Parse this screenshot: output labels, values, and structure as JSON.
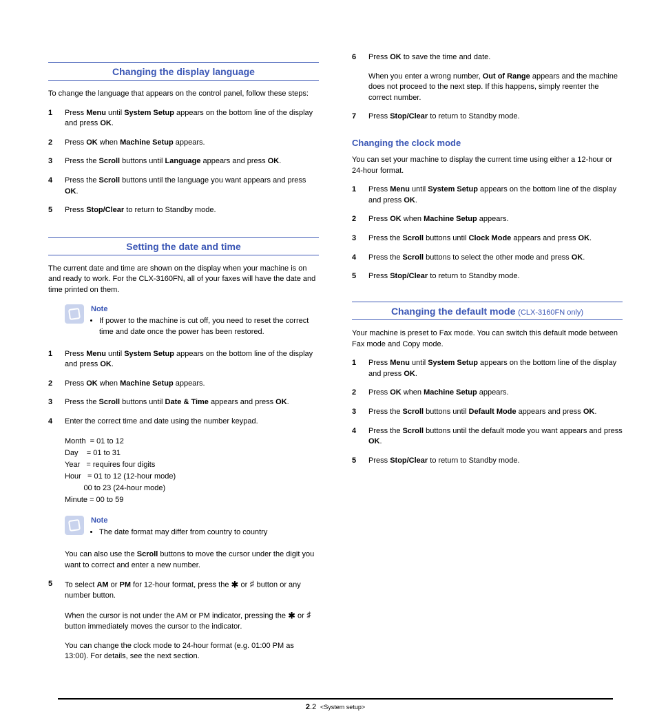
{
  "left": {
    "sec1": {
      "title": "Changing the display language",
      "intro": "To change the language that appears on the control panel, follow these steps:",
      "steps": [
        {
          "n": "1",
          "html": "Press <b>Menu</b> until <b>System Setup</b> appears on the bottom line of the display and press <b>OK</b>."
        },
        {
          "n": "2",
          "html": "Press <b>OK</b> when <b>Machine Setup</b> appears."
        },
        {
          "n": "3",
          "html": "Press the <b>Scroll</b> buttons until <b>Language</b> appears and press <b>OK</b>."
        },
        {
          "n": "4",
          "html": "Press the <b>Scroll</b> buttons until the language you want appears and press <b>OK</b>."
        },
        {
          "n": "5",
          "html": "Press <b>Stop/Clear</b> to return to Standby mode."
        }
      ]
    },
    "sec2": {
      "title": "Setting the date and time",
      "intro": "The current date and time are shown on the display when your machine is on and ready to work. For the CLX-3160FN, all of your faxes will have the date and time printed on them.",
      "note1": {
        "label": "Note",
        "text": "If power to the machine is cut off, you need to reset the correct time and date once the power has been restored."
      },
      "steps_a": [
        {
          "n": "1",
          "html": "Press <b>Menu</b> until <b>System Setup</b> appears on the bottom line of the display and press <b>OK</b>."
        },
        {
          "n": "2",
          "html": "Press <b>OK</b> when <b>Machine Setup</b> appears."
        },
        {
          "n": "3",
          "html": "Press the <b>Scroll</b> buttons until <b>Date & Time</b> appears and press <b>OK</b>."
        },
        {
          "n": "4",
          "html": "Enter the correct time and date using the number keypad."
        }
      ],
      "ranges": [
        "Month  = 01 to 12",
        "Day    = 01 to 31",
        "Year   = requires four digits",
        "Hour   = 01 to 12 (12-hour mode)",
        "         00 to 23 (24-hour mode)",
        "Minute = 00 to 59"
      ],
      "note2": {
        "label": "Note",
        "text": "The date format may differ from country to country"
      },
      "after_note_para_html": "You can also use the <b>Scroll</b> buttons to move the cursor under the digit you want to correct and enter a new number.",
      "step5": {
        "n": "5",
        "html": "To select <b>AM</b> or <b>PM</b> for 12-hour format, press the <span class='star'>✱</span> or <span class='hash'>♯</span> button or any number button."
      },
      "tail1_html": "When the cursor is not under the AM or PM indicator, pressing the <span class='star'>✱</span> or <span class='hash'>♯</span> button immediately moves the cursor to the indicator.",
      "tail2": "You can change the clock mode to 24-hour format (e.g. 01:00 PM as 13:00). For details, see the next section."
    }
  },
  "right": {
    "cont_steps": [
      {
        "n": "6",
        "html": "Press <b>OK</b> to save the time and date."
      }
    ],
    "cont_para_html": "When you enter a wrong number, <b>Out of Range</b> appears and the machine does not proceed to the next step. If this happens, simply reenter the correct number.",
    "cont_step7": {
      "n": "7",
      "html": "Press <b>Stop/Clear</b> to return to Standby mode."
    },
    "sub1": {
      "heading": "Changing the clock mode",
      "intro": "You can set your machine to display the current time using either a 12-hour or 24-hour format.",
      "steps": [
        {
          "n": "1",
          "html": "Press <b>Menu</b> until <b>System Setup</b> appears on the bottom line of the display and press <b>OK</b>."
        },
        {
          "n": "2",
          "html": "Press <b>OK</b> when <b>Machine Setup</b> appears."
        },
        {
          "n": "3",
          "html": "Press the <b>Scroll</b> buttons until <b>Clock Mode</b> appears and press <b>OK</b>."
        },
        {
          "n": "4",
          "html": "Press the <b>Scroll</b> buttons to select the other mode and press <b>OK</b>."
        },
        {
          "n": "5",
          "html": "Press <b>Stop/Clear</b> to return to Standby mode."
        }
      ]
    },
    "sec3": {
      "title_main": "Changing the default mode ",
      "title_sub": "(CLX-3160FN only)",
      "intro": "Your machine is preset to Fax mode. You can switch this default mode between Fax mode and Copy mode.",
      "steps": [
        {
          "n": "1",
          "html": "Press <b>Menu</b> until <b>System Setup</b> appears on the bottom line of the display and press <b>OK</b>."
        },
        {
          "n": "2",
          "html": "Press <b>OK</b> when <b>Machine Setup</b> appears."
        },
        {
          "n": "3",
          "html": "Press the <b>Scroll</b> buttons until <b>Default Mode</b> appears and press <b>OK</b>."
        },
        {
          "n": "4",
          "html": "Press the <b>Scroll</b> buttons until the default mode you want appears and press <b>OK</b>."
        },
        {
          "n": "5",
          "html": "Press <b>Stop/Clear</b> to return to Standby mode."
        }
      ]
    }
  },
  "footer": {
    "page_bold": "2",
    "page_rest": ".2",
    "label": "<System setup>"
  }
}
